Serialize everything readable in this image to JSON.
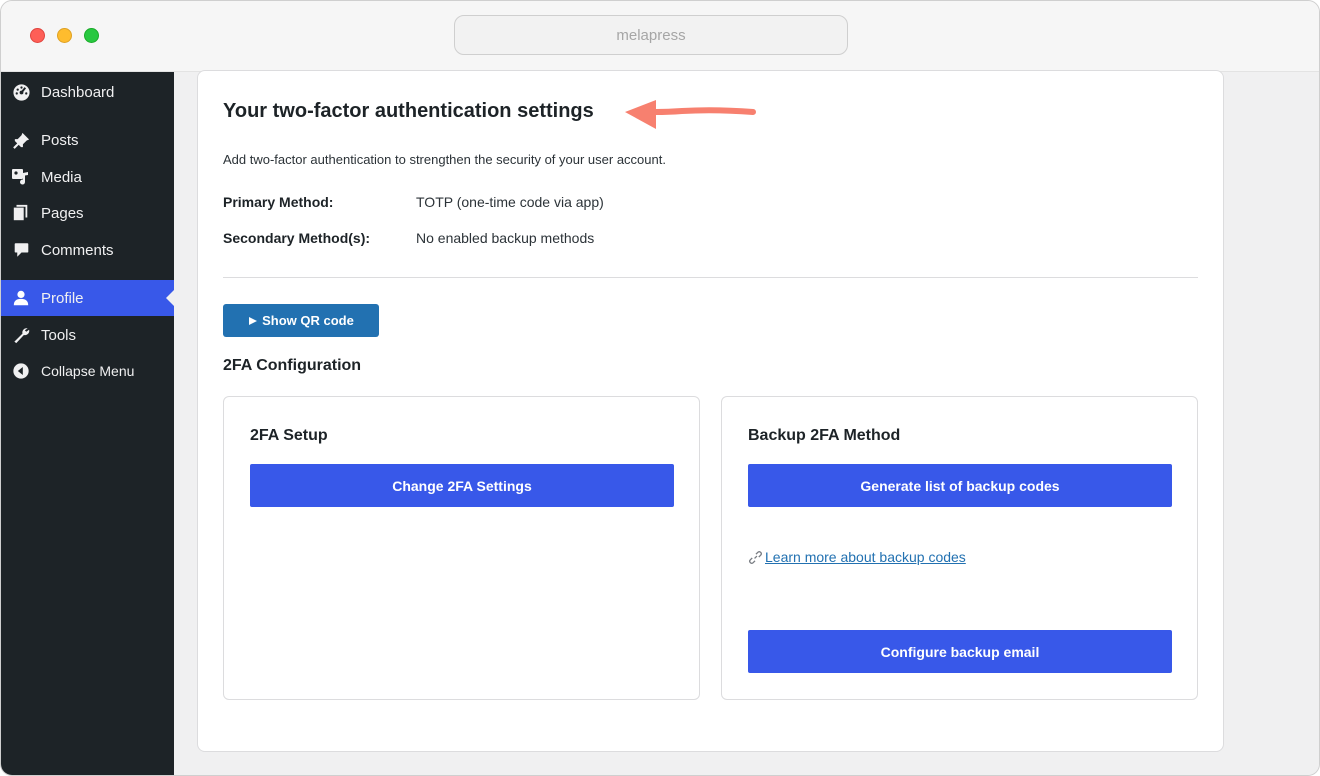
{
  "browser": {
    "url": "melapress",
    "colors": {
      "close": "#fe5f57",
      "minimize": "#febc2e",
      "zoom": "#28c840"
    }
  },
  "sidebar": {
    "items": [
      {
        "label": "Dashboard",
        "icon": "dashboard-icon"
      },
      {
        "label": "Posts",
        "icon": "pin-icon"
      },
      {
        "label": "Media",
        "icon": "media-icon"
      },
      {
        "label": "Pages",
        "icon": "pages-icon"
      },
      {
        "label": "Comments",
        "icon": "comment-icon"
      },
      {
        "label": "Profile",
        "icon": "user-icon",
        "active": true
      },
      {
        "label": "Tools",
        "icon": "wrench-icon"
      },
      {
        "label": "Collapse Menu",
        "icon": "collapse-icon"
      }
    ],
    "colors": {
      "background": "#1d2327",
      "active": "#3858e9"
    }
  },
  "main": {
    "title": "Your two-factor authentication settings",
    "intro": "Add two-factor authentication to strengthen the security of your user account.",
    "primary_label": "Primary Method:",
    "primary_value": "TOTP (one-time code via app)",
    "secondary_label": "Secondary Method(s):",
    "secondary_value": "No enabled backup methods",
    "qr_button": "Show QR code",
    "qr_icon": "play-triangle-icon",
    "config_title": "2FA Configuration",
    "setup": {
      "title": "2FA Setup",
      "button": "Change 2FA Settings"
    },
    "backup": {
      "title": "Backup 2FA Method",
      "generate_button": "Generate list of backup codes",
      "learn_link": "Learn more about backup codes",
      "email_button": "Configure backup email"
    },
    "colors": {
      "primary_button": "#3858e9",
      "qr_button": "#2271b1",
      "annotation_arrow": "#f7806f"
    }
  }
}
